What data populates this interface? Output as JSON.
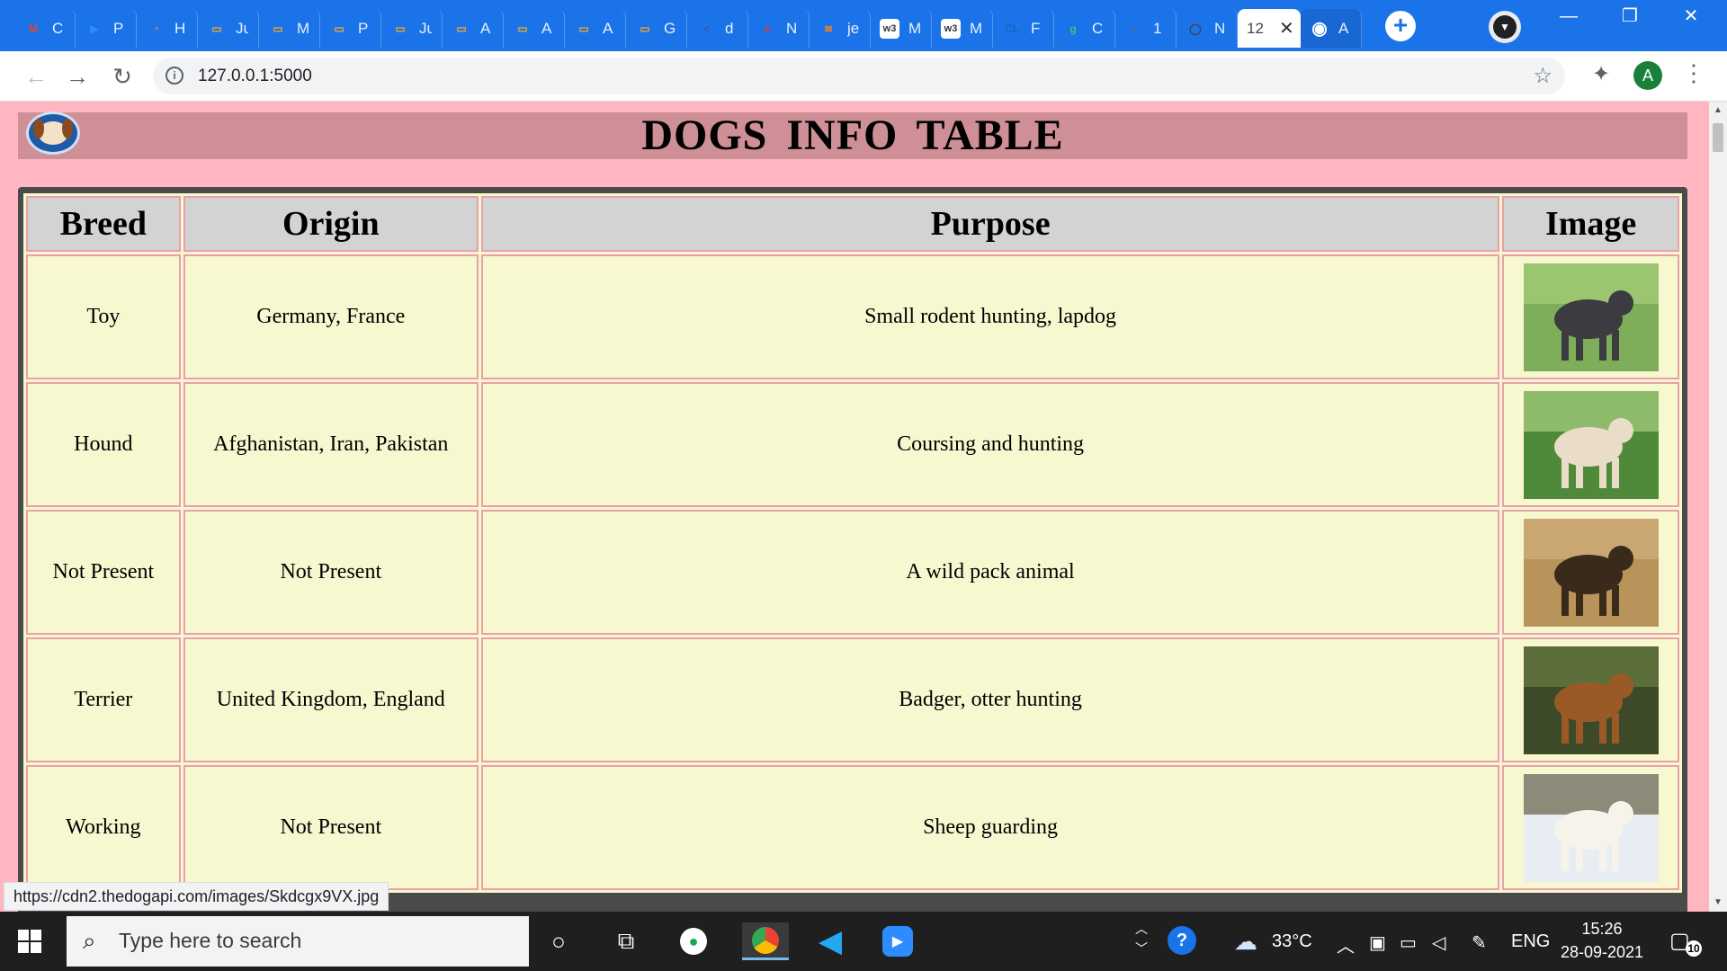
{
  "browser": {
    "tabs": [
      {
        "fav": "M",
        "text": "C",
        "color": "#ea4335"
      },
      {
        "fav": "▶",
        "text": "P",
        "color": "#2d8cff"
      },
      {
        "fav": "◔",
        "text": "H",
        "color": "#f57c00"
      },
      {
        "fav": "▭",
        "text": "Ju",
        "color": "#f5a623"
      },
      {
        "fav": "▭",
        "text": "M",
        "color": "#f5a623"
      },
      {
        "fav": "▭",
        "text": "P",
        "color": "#f5a623"
      },
      {
        "fav": "▭",
        "text": "Ju",
        "color": "#f5a623"
      },
      {
        "fav": "▭",
        "text": "A",
        "color": "#f5a623"
      },
      {
        "fav": "▭",
        "text": "A",
        "color": "#f5a623"
      },
      {
        "fav": "▭",
        "text": "A",
        "color": "#f5a623"
      },
      {
        "fav": "▭",
        "text": "G",
        "color": "#f5a623"
      },
      {
        "fav": "<",
        "text": "d",
        "color": "#3f51b5"
      },
      {
        "fav": "e",
        "text": "N",
        "color": "#e53935"
      },
      {
        "fav": "≋",
        "text": "je",
        "color": "#f48024"
      },
      {
        "fav": "w3",
        "text": "M",
        "color": "#ffffff"
      },
      {
        "fav": "w3",
        "text": "M",
        "color": "#ffffff"
      },
      {
        "fav": "CL",
        "text": "F",
        "color": "#1565c0"
      },
      {
        "fav": "g",
        "text": "C",
        "color": "#2ecc71"
      },
      {
        "fav": "◐",
        "text": "1",
        "color": "#616161"
      },
      {
        "fav": "◯",
        "text": "N",
        "color": "#424242"
      }
    ],
    "active_tab": {
      "text": "12",
      "close": "✕"
    },
    "github_tab": {
      "fav": "◉",
      "text": "A"
    },
    "new_tab": "+",
    "window": {
      "minimize": "—",
      "restore": "❐",
      "close": "✕"
    },
    "nav": {
      "back": "←",
      "forward": "→",
      "reload": "↻"
    },
    "url": "127.0.0.1:5000",
    "info_icon": "i",
    "bookmark": "☆",
    "extensions": "✦",
    "account": "A",
    "menu": "⋮",
    "status_url": "https://cdn2.thedogapi.com/images/Skdcgx9VX.jpg"
  },
  "page": {
    "title": "DOGS INFO TABLE",
    "columns": [
      "Breed",
      "Origin",
      "Purpose",
      "Image"
    ],
    "rows": [
      {
        "breed": "Toy",
        "origin": "Germany, France",
        "purpose": "Small rodent hunting, lapdog",
        "image": "black-shaggy-dog"
      },
      {
        "breed": "Hound",
        "origin": "Afghanistan, Iran, Pakistan",
        "purpose": "Coursing and hunting",
        "image": "afghan-hound"
      },
      {
        "breed": "Not Present",
        "origin": "Not Present",
        "purpose": "A wild pack animal",
        "image": "african-wild-dog"
      },
      {
        "breed": "Terrier",
        "origin": "United Kingdom, England",
        "purpose": "Badger, otter hunting",
        "image": "airedale-terrier"
      },
      {
        "breed": "Working",
        "origin": "Not Present",
        "purpose": "Sheep guarding",
        "image": "white-dog-snow"
      }
    ]
  },
  "taskbar": {
    "search_placeholder": "Type here to search",
    "temperature": "33°C",
    "language": "ENG",
    "time": "15:26",
    "date": "28-09-2021",
    "notifications": "10"
  }
}
